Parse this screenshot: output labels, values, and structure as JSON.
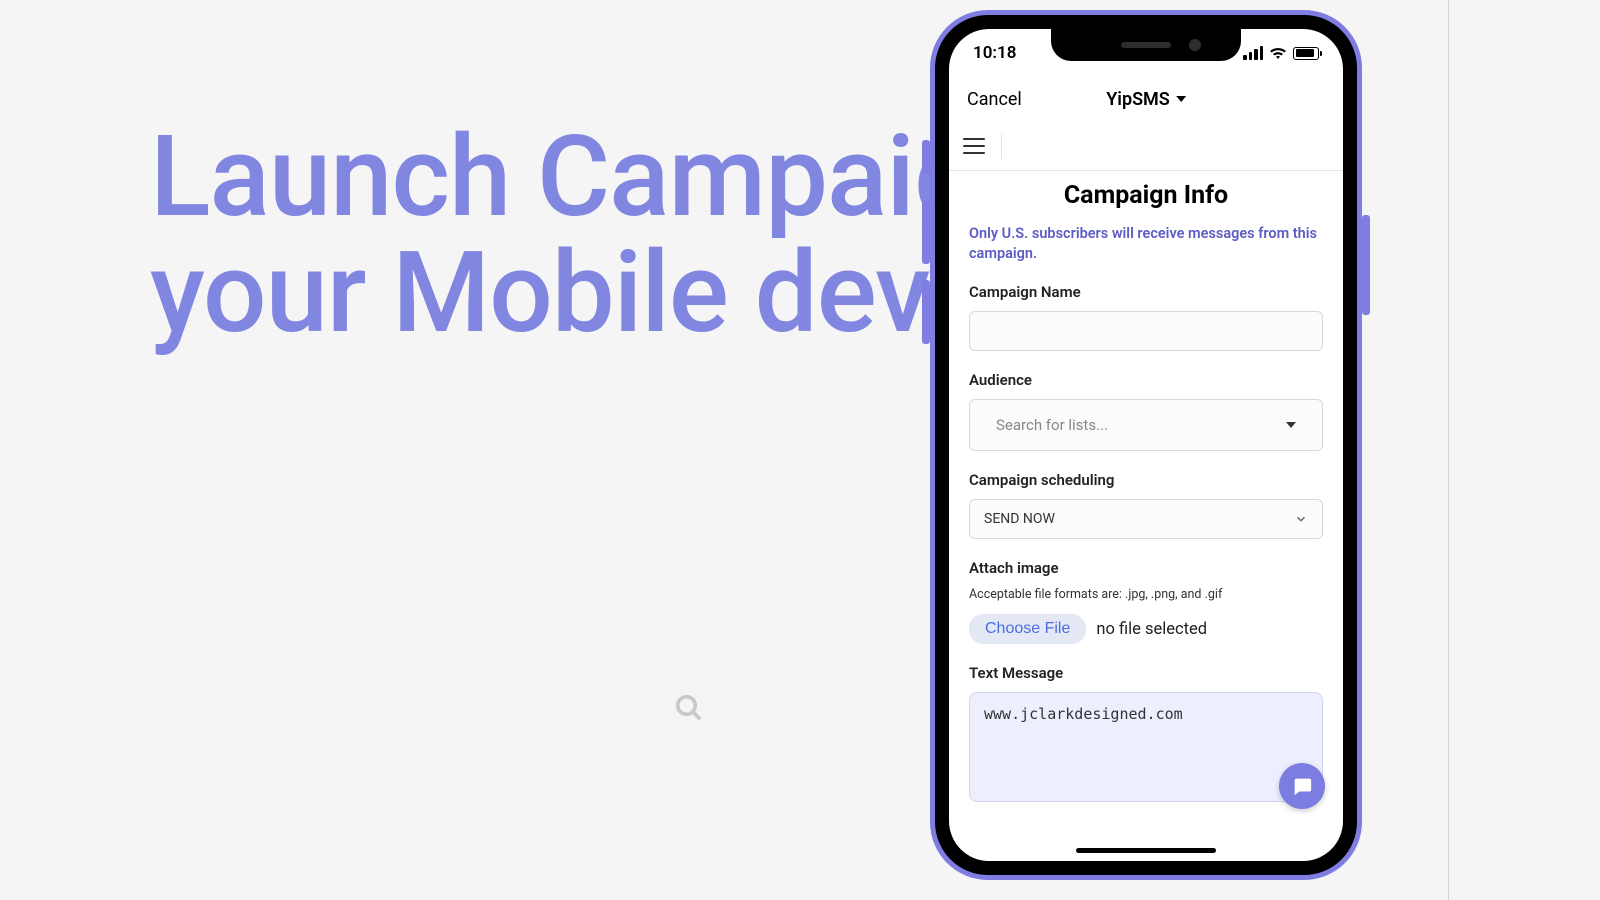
{
  "hero": "Launch Campaign's from your Mobile device",
  "status": {
    "time": "10:18"
  },
  "header": {
    "cancel": "Cancel",
    "title": "YipSMS"
  },
  "page": {
    "title": "Campaign Info",
    "notice": "Only U.S. subscribers will receive messages from this campaign."
  },
  "fields": {
    "name_label": "Campaign Name",
    "name_value": "",
    "audience_label": "Audience",
    "audience_placeholder": "Search for lists...",
    "scheduling_label": "Campaign scheduling",
    "scheduling_value": "SEND NOW",
    "attach_label": "Attach image",
    "attach_hint": "Acceptable file formats are: .jpg, .png, and .gif",
    "choose_file": "Choose File",
    "file_status": "no file selected",
    "text_label": "Text Message",
    "text_value": "www.jclarkdesigned.com"
  }
}
